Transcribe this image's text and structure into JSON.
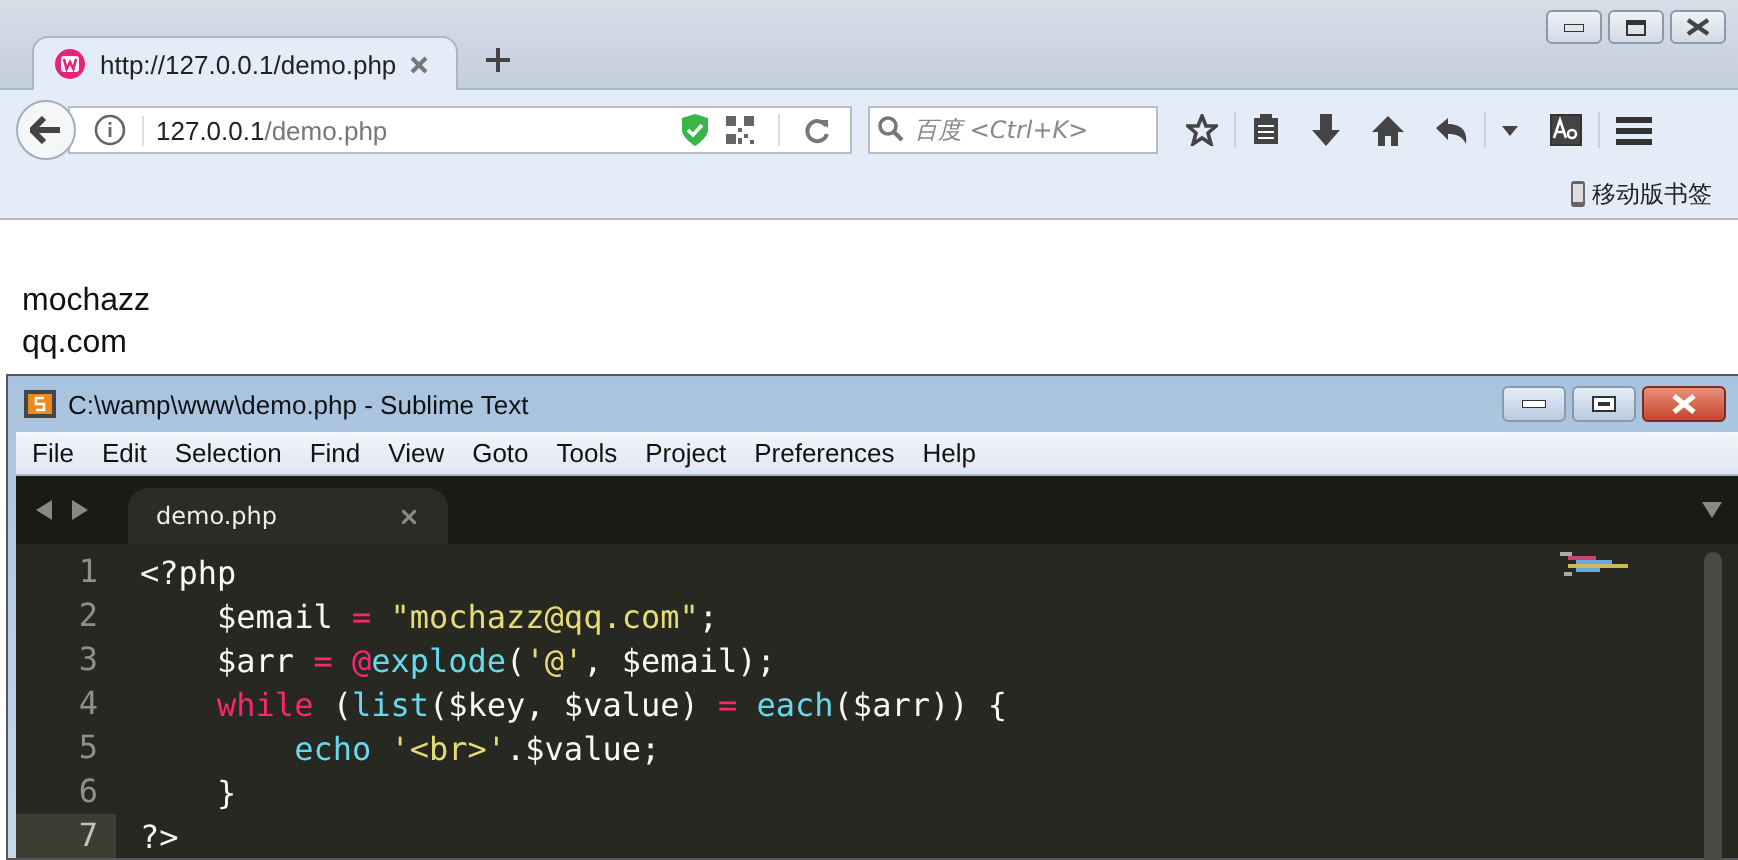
{
  "browser": {
    "tab": {
      "title": "http://127.0.0.1/demo.php",
      "selected": true
    },
    "address": {
      "host": "127.0.0.1",
      "path": "/demo.php"
    },
    "search": {
      "placeholder": "百度 <Ctrl+K>"
    },
    "bookmark": "移动版书签",
    "page_lines": [
      "mochazz",
      "qq.com"
    ]
  },
  "editor": {
    "title": "C:\\wamp\\www\\demo.php - Sublime Text",
    "menu": [
      "File",
      "Edit",
      "Selection",
      "Find",
      "View",
      "Goto",
      "Tools",
      "Project",
      "Preferences",
      "Help"
    ],
    "tab": {
      "title": "demo.php",
      "selected": true
    },
    "lines": [
      {
        "number": "1",
        "current": false,
        "tokens": [
          {
            "text": "<?php",
            "kind": "plain"
          }
        ]
      },
      {
        "number": "2",
        "current": false,
        "tokens": [
          {
            "text": "    $email ",
            "kind": "plain"
          },
          {
            "text": "= ",
            "kind": "operator"
          },
          {
            "text": "\"mochazz@qq.com\"",
            "kind": "string"
          },
          {
            "text": ";",
            "kind": "plain"
          }
        ]
      },
      {
        "number": "3",
        "current": false,
        "tokens": [
          {
            "text": "    $arr ",
            "kind": "plain"
          },
          {
            "text": "= @",
            "kind": "operator"
          },
          {
            "text": "explode",
            "kind": "function"
          },
          {
            "text": "(",
            "kind": "plain"
          },
          {
            "text": "'@'",
            "kind": "string"
          },
          {
            "text": ", $email);",
            "kind": "plain"
          }
        ]
      },
      {
        "number": "4",
        "current": false,
        "tokens": [
          {
            "text": "    while",
            "kind": "operator"
          },
          {
            "text": " (",
            "kind": "plain"
          },
          {
            "text": "list",
            "kind": "function"
          },
          {
            "text": "($key, $value) ",
            "kind": "plain"
          },
          {
            "text": "= ",
            "kind": "operator"
          },
          {
            "text": "each",
            "kind": "function"
          },
          {
            "text": "($arr)) {",
            "kind": "plain"
          }
        ]
      },
      {
        "number": "5",
        "current": false,
        "tokens": [
          {
            "text": "        echo ",
            "kind": "function"
          },
          {
            "text": "'<br>'",
            "kind": "string"
          },
          {
            "text": ".$value;",
            "kind": "plain"
          }
        ]
      },
      {
        "number": "6",
        "current": false,
        "tokens": [
          {
            "text": "    }",
            "kind": "plain"
          }
        ]
      },
      {
        "number": "7",
        "current": true,
        "tokens": [
          {
            "text": "?>",
            "kind": "plain"
          }
        ]
      }
    ]
  }
}
